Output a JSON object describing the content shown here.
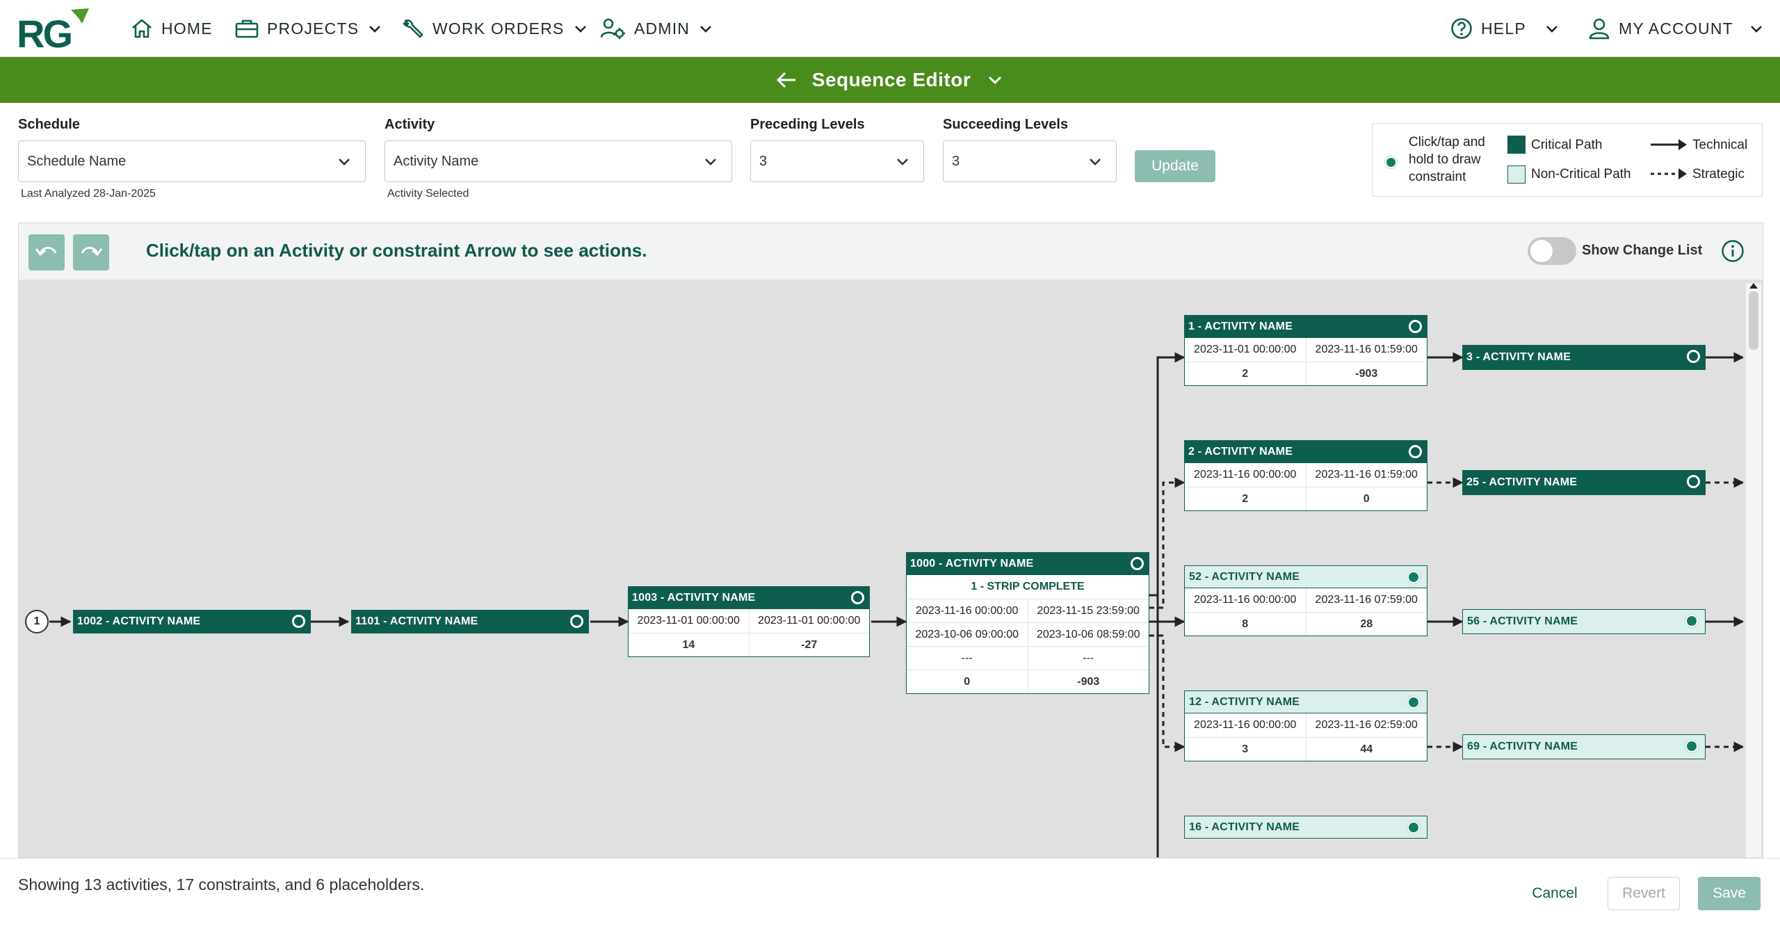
{
  "nav": {
    "home": "HOME",
    "projects": "PROJECTS",
    "work_orders": "WORK ORDERS",
    "admin": "ADMIN",
    "help": "HELP",
    "account": "MY ACCOUNT"
  },
  "header": {
    "title": "Sequence Editor"
  },
  "filters": {
    "schedule": {
      "label": "Schedule",
      "value": "Schedule Name",
      "sub": "Last Analyzed 28-Jan-2025"
    },
    "activity": {
      "label": "Activity",
      "value": "Activity Name",
      "sub": "Activity Selected"
    },
    "preceding": {
      "label": "Preceding Levels",
      "value": "3"
    },
    "succeeding": {
      "label": "Succeeding Levels",
      "value": "3"
    },
    "update_label": "Update"
  },
  "legend": {
    "draw_hint": "Click/tap and hold to draw constraint",
    "critical": "Critical Path",
    "noncritical": "Non-Critical Path",
    "technical": "Technical",
    "strategic": "Strategic"
  },
  "canvas": {
    "hint": "Click/tap on an Activity or constraint Arrow to see actions.",
    "show_change_list": "Show Change List",
    "start_node": "1"
  },
  "activities": [
    {
      "id": "a1002",
      "name": "1002 - ACTIVITY NAME",
      "critical": true,
      "rows": []
    },
    {
      "id": "a1101",
      "name": "1101 - ACTIVITY NAME",
      "critical": true,
      "rows": []
    },
    {
      "id": "a1003",
      "name": "1003 - ACTIVITY NAME",
      "critical": true,
      "rows": [
        [
          "2023-11-01 00:00:00",
          "2023-11-01 00:00:00"
        ],
        [
          "14",
          "-27"
        ]
      ]
    },
    {
      "id": "a1000",
      "name": "1000 - ACTIVITY NAME",
      "critical": true,
      "rows": [
        [
          "1 - STRIP COMPLETE"
        ],
        [
          "2023-11-16 00:00:00",
          "2023-11-15 23:59:00"
        ],
        [
          "2023-10-06 09:00:00",
          "2023-10-06 08:59:00"
        ],
        [
          "---",
          "---"
        ],
        [
          "0",
          "-903"
        ]
      ]
    },
    {
      "id": "a1",
      "name": "1 - ACTIVITY NAME",
      "critical": true,
      "rows": [
        [
          "2023-11-01 00:00:00",
          "2023-11-16 01:59:00"
        ],
        [
          "2",
          "-903"
        ]
      ]
    },
    {
      "id": "a2",
      "name": "2 - ACTIVITY NAME",
      "critical": true,
      "rows": [
        [
          "2023-11-16 00:00:00",
          "2023-11-16 01:59:00"
        ],
        [
          "2",
          "0"
        ]
      ]
    },
    {
      "id": "a52",
      "name": "52 - ACTIVITY NAME",
      "critical": false,
      "rows": [
        [
          "2023-11-16 00:00:00",
          "2023-11-16 07:59:00"
        ],
        [
          "8",
          "28"
        ]
      ]
    },
    {
      "id": "a12",
      "name": "12 - ACTIVITY NAME",
      "critical": false,
      "rows": [
        [
          "2023-11-16 00:00:00",
          "2023-11-16 02:59:00"
        ],
        [
          "3",
          "44"
        ]
      ]
    },
    {
      "id": "a16",
      "name": "16 - ACTIVITY NAME",
      "critical": false,
      "rows": []
    },
    {
      "id": "a3",
      "name": "3 - ACTIVITY NAME",
      "critical": true,
      "rows": []
    },
    {
      "id": "a25",
      "name": "25 - ACTIVITY NAME",
      "critical": true,
      "rows": []
    },
    {
      "id": "a56",
      "name": "56 - ACTIVITY NAME",
      "critical": false,
      "rows": []
    },
    {
      "id": "a69",
      "name": "69 - ACTIVITY NAME",
      "critical": false,
      "rows": []
    }
  ],
  "footer": {
    "summary": "Showing 13 activities, 17 constraints, and 6 placeholders.",
    "cancel": "Cancel",
    "revert": "Revert",
    "save": "Save"
  },
  "colors": {
    "brand_green": "#4a8c1c",
    "critical": "#0e5e50",
    "noncritical_fill": "#dbefed",
    "action_disabled": "#8dbcb0"
  }
}
